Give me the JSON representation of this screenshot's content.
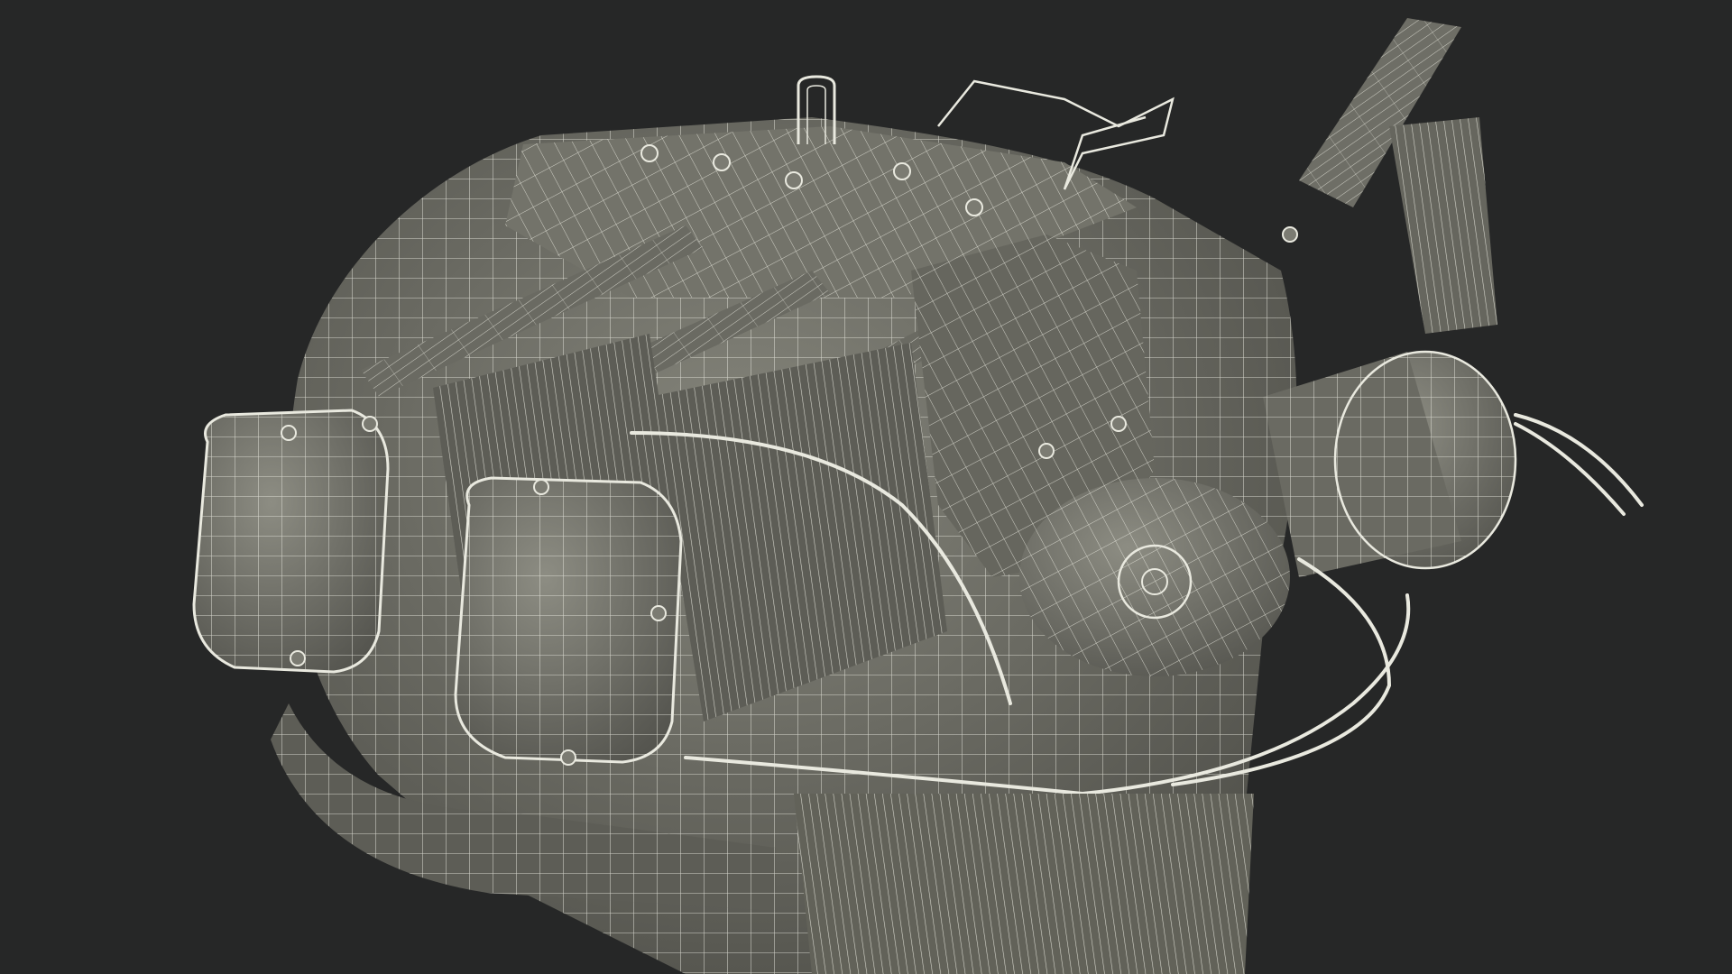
{
  "scene": {
    "subject_icon": "wireframe-engine-icon",
    "colors": {
      "background": "#262727",
      "mesh_fill": "#6f6f66",
      "mesh_fill_dark": "#55554e",
      "mesh_fill_light": "#8a8a80",
      "wire": "#e9e9df"
    }
  }
}
